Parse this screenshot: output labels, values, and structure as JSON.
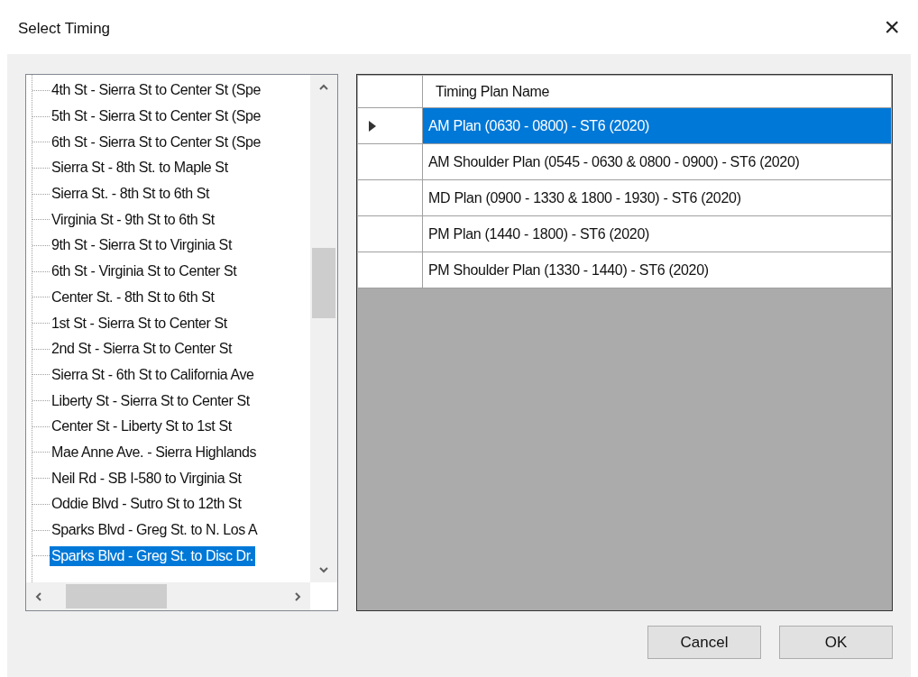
{
  "window": {
    "title": "Select Timing",
    "close": "×"
  },
  "tree": {
    "items": [
      {
        "label": "4th St - Sierra St to Center St (Spe",
        "selected": false
      },
      {
        "label": "5th St - Sierra St to Center St (Spe",
        "selected": false
      },
      {
        "label": "6th St - Sierra St to Center St (Spe",
        "selected": false
      },
      {
        "label": "Sierra St - 8th St. to Maple St",
        "selected": false
      },
      {
        "label": "Sierra St. - 8th St to 6th St",
        "selected": false
      },
      {
        "label": "Virginia St - 9th St to 6th St",
        "selected": false
      },
      {
        "label": "9th St - Sierra St to Virginia St",
        "selected": false
      },
      {
        "label": "6th St - Virginia St to Center St",
        "selected": false
      },
      {
        "label": "Center St. -  8th St to 6th St",
        "selected": false
      },
      {
        "label": "1st St - Sierra St to Center St",
        "selected": false
      },
      {
        "label": "2nd St - Sierra St to Center St",
        "selected": false
      },
      {
        "label": "Sierra St - 6th St to California Ave",
        "selected": false
      },
      {
        "label": "Liberty St - Sierra St to Center St",
        "selected": false
      },
      {
        "label": "Center St - Liberty St to 1st St",
        "selected": false
      },
      {
        "label": "Mae Anne Ave. - Sierra Highlands",
        "selected": false
      },
      {
        "label": "Neil Rd - SB I-580 to Virginia St",
        "selected": false
      },
      {
        "label": "Oddie Blvd - Sutro St to 12th St",
        "selected": false
      },
      {
        "label": "Sparks Blvd - Greg St. to N. Los A",
        "selected": false
      },
      {
        "label": "Sparks Blvd - Greg St. to Disc Dr.",
        "selected": true
      }
    ]
  },
  "table": {
    "columns": [
      "Timing Plan Name"
    ],
    "rows": [
      {
        "name": "AM Plan (0630 - 0800) - ST6 (2020)",
        "selected": true
      },
      {
        "name": "AM Shoulder Plan (0545 - 0630 & 0800 - 0900) - ST6 (2020)",
        "selected": false
      },
      {
        "name": "MD Plan (0900 - 1330 & 1800 - 1930) - ST6 (2020)",
        "selected": false
      },
      {
        "name": "PM Plan (1440 - 1800) - ST6 (2020)",
        "selected": false
      },
      {
        "name": "PM Shoulder Plan (1330 - 1440) - ST6 (2020)",
        "selected": false
      }
    ]
  },
  "buttons": [
    "Cancel",
    "OK"
  ]
}
